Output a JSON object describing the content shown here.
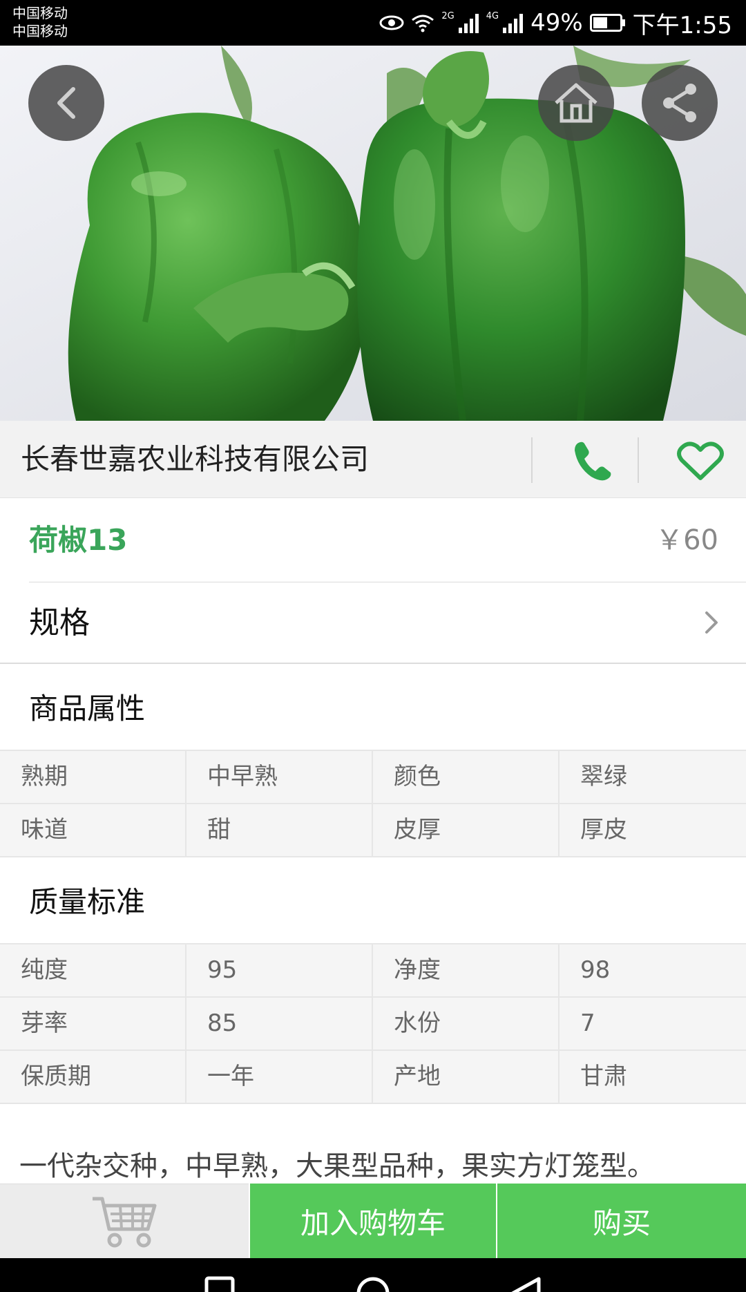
{
  "status_bar": {
    "carrier_1": "中国移动",
    "carrier_2": "中国移动",
    "network_2g": "2G",
    "network_4g": "4G",
    "battery": "49%",
    "time": "下午1:55"
  },
  "hero": {
    "image_subject": "green bell peppers",
    "icons": [
      "back-icon",
      "home-icon",
      "share-icon"
    ]
  },
  "company": {
    "name": "长春世嘉农业科技有限公司",
    "icons": [
      "phone-icon",
      "heart-icon"
    ]
  },
  "product": {
    "name": "荷椒13",
    "price": "￥60"
  },
  "spec": {
    "label": "规格"
  },
  "attributes": {
    "title": "商品属性",
    "rows": [
      [
        "熟期",
        "中早熟",
        "颜色",
        "翠绿"
      ],
      [
        "味道",
        "甜",
        "皮厚",
        "厚皮"
      ]
    ]
  },
  "quality": {
    "title": "质量标准",
    "rows": [
      [
        "纯度",
        "95",
        "净度",
        "98"
      ],
      [
        "芽率",
        "85",
        "水份",
        "7"
      ],
      [
        "保质期",
        "一年",
        "产地",
        "甘肃"
      ]
    ]
  },
  "description": "一代杂交种，中早熟，大果型品种，果实方灯笼型。",
  "bottom_bar": {
    "add_to_cart": "加入购物车",
    "buy": "购买"
  },
  "colors": {
    "accent_green": "#55c95a",
    "product_name_green": "#3aa55a",
    "icon_green": "#2fa84f"
  }
}
